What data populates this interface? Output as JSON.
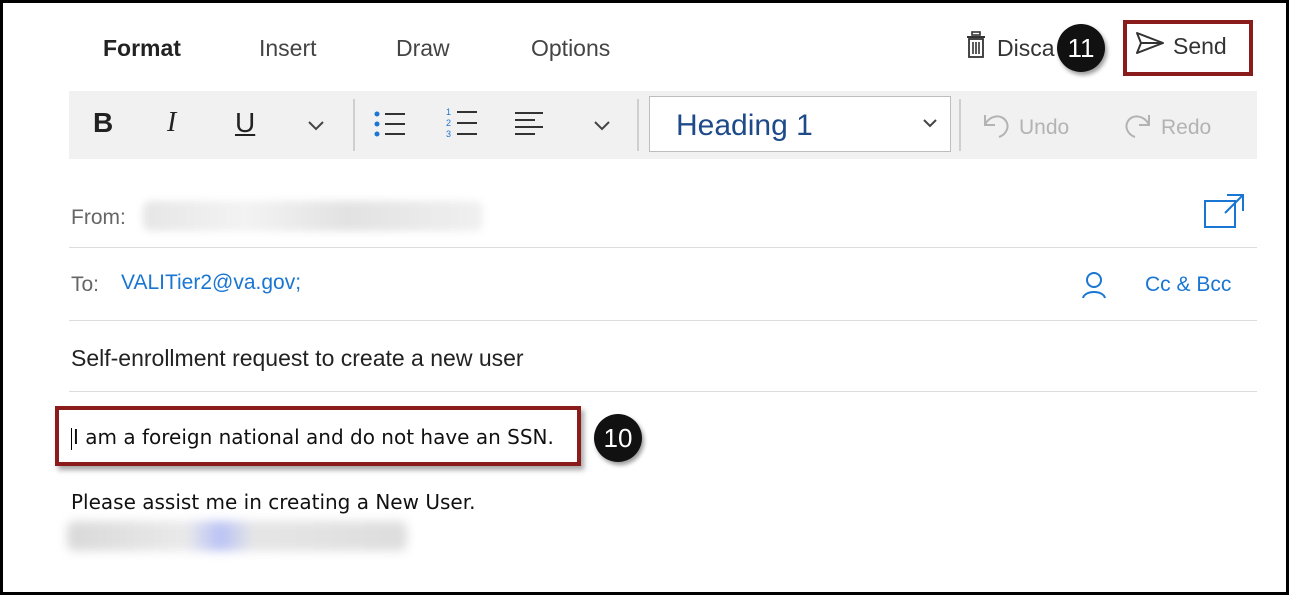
{
  "tabs": [
    {
      "label": "Format",
      "active": true
    },
    {
      "label": "Insert",
      "active": false
    },
    {
      "label": "Draw",
      "active": false
    },
    {
      "label": "Options",
      "active": false
    }
  ],
  "actions": {
    "discard_label": "Disca",
    "send_label": "Send"
  },
  "badges": {
    "send": "11",
    "body": "10"
  },
  "toolbar": {
    "bold": "B",
    "italic": "I",
    "underline": "U",
    "style_value": "Heading 1",
    "undo_label": "Undo",
    "redo_label": "Redo"
  },
  "fields": {
    "from_label": "From:",
    "to_label": "To:",
    "to_value": "VALITier2@va.gov;",
    "cc_label": "Cc & Bcc",
    "subject": "Self-enrollment request to create a new user"
  },
  "body": {
    "line1": "I am a foreign national and do not have an SSN.",
    "line2": "Please assist me in creating a New User."
  },
  "colors": {
    "link": "#1976d2",
    "highlight": "#8b1c1c",
    "heading": "#1e4a8a"
  }
}
